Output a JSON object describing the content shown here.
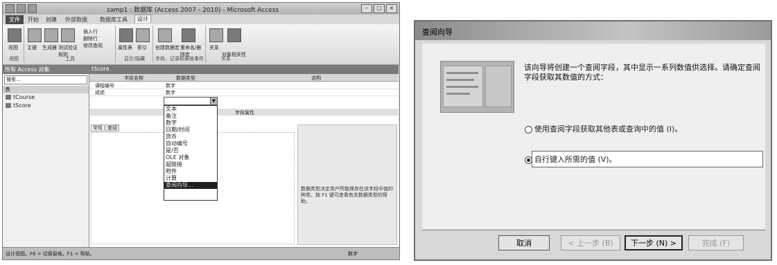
{
  "access": {
    "title": "samp1 : 数据库 (Access 2007 - 2010) - Microsoft Access",
    "tabs": [
      "文件",
      "开始",
      "创建",
      "外部数据",
      "数据库工具",
      "设计"
    ],
    "ribbon": {
      "view_label": "视图",
      "primary_key_label": "主键",
      "builder_label": "生成器",
      "test_rules_label": "测试验证规则",
      "insert_rows_label": "插入行",
      "delete_rows_label": "删除行",
      "modify_lookups_label": "修改查阅",
      "property_sheet_label": "属性表",
      "indexes_label": "索引",
      "macro_label": "创建数据宏",
      "rename_macro_label": "重命名/删除宏",
      "relationships_label": "关系",
      "dependencies_label": "对象相关性",
      "groups": [
        "视图",
        "工具",
        "显示/隐藏",
        "字段、记录和表格事件",
        "关系"
      ]
    },
    "nav": {
      "header": "所有 Access 对象",
      "search": "搜索...",
      "group": "表",
      "items": [
        "tCourse",
        "tScore"
      ]
    },
    "doc": {
      "tab": "tScore",
      "col_field": "字段名称",
      "col_type": "数据类型",
      "col_desc": "说明",
      "rows": [
        {
          "field": "课程编号",
          "type": "数字"
        },
        {
          "field": "成绩",
          "type": "数字"
        }
      ],
      "field_props": "字段属性",
      "prop_tabs": [
        "常规",
        "查阅"
      ],
      "help": "数据类型决定用户所能保存在该字段中值的种类。按 F1 键可查看有关数据类型的帮助。"
    },
    "type_options": [
      "文本",
      "备注",
      "数字",
      "日期/时间",
      "货币",
      "自动编号",
      "是/否",
      "OLE 对象",
      "超链接",
      "附件",
      "计算",
      "查阅向导..."
    ],
    "status": {
      "left": "设计视图。F6 = 切换窗格。F1 = 帮助。",
      "right": "数字"
    }
  },
  "wizard": {
    "title": "查阅向导",
    "description": "该向导将创建一个查阅字段，其中显示一系列数值供选择。请确定查阅字段获取其数值的方式：",
    "option1": "使用查阅字段获取其他表或查询中的值 (I)。",
    "option2": "自行键入所需的值 (V)。",
    "selected": "option2",
    "buttons": {
      "cancel": "取消",
      "back": "< 上一步 (B)",
      "next": "下一步 (N) >",
      "finish": "完成 (F)"
    }
  }
}
